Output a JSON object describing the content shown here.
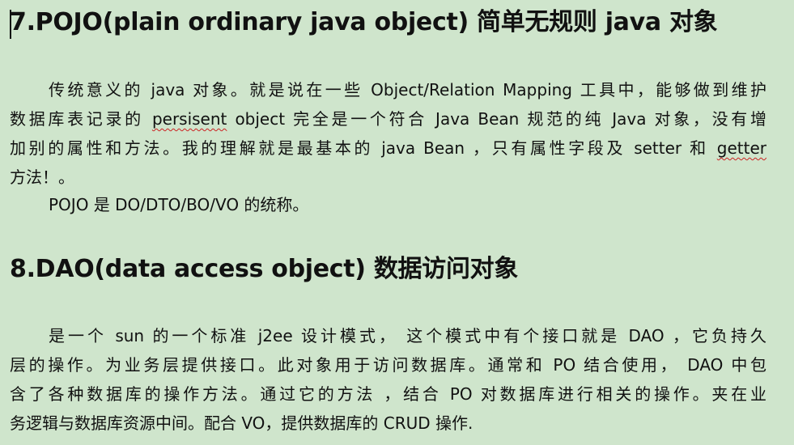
{
  "section1": {
    "heading": "7.POJO(plain ordinary java object)  简单无规则  java  对象",
    "para1": {
      "line1": "传统意义的  java  对象。就是说在一些  Object/Relation Mapping  工具中，能够做到维护",
      "line2_a": "数据库表记录的  ",
      "line2_misspelled": "persisent",
      "line2_b": " object  完全是一个符合  Java Bean  规范的纯  Java  对象，没有增",
      "line3_a": "加别的属性和方法。我的理解就是最基本的  java Bean  ，只有属性字段及  setter  和  ",
      "line3_misspelled": "getter",
      "line4": "方法！。"
    },
    "para2": "POJO 是 DO/DTO/BO/VO 的统称。"
  },
  "section2": {
    "heading": "8.DAO(data access object)  数据访问对象",
    "para": {
      "line1": "是一个  sun  的一个标准  j2ee  设计模式，   这个模式中有个接口就是  DAO  ，它负持久",
      "line2": "层的操作。为业务层提供接口。此对象用于访问数据库。通常和  PO  结合使用，  DAO  中包",
      "line3": "含了各种数据库的操作方法。通过它的方法 ，结合  PO  对数据库进行相关的操作。夹在业",
      "line4": "务逻辑与数据库资源中间。配合  VO，提供数据库的  CRUD  操作."
    }
  }
}
